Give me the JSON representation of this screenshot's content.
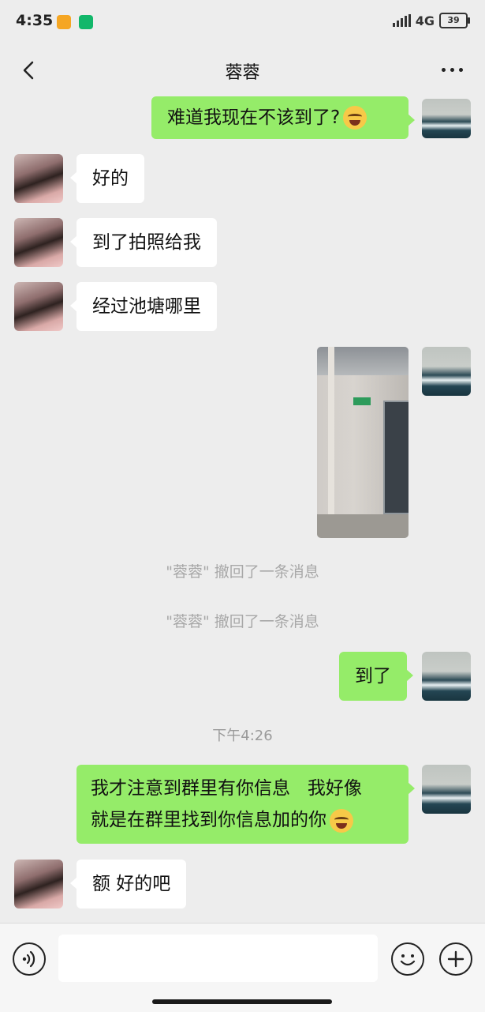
{
  "status_bar": {
    "time": "4:35",
    "network": "4G",
    "battery": "39"
  },
  "header": {
    "title": "蓉蓉"
  },
  "messages": [
    {
      "from": "me",
      "text": "难道我现在不该到了?",
      "emoji": "face-with-tears-of-joy"
    },
    {
      "from": "contact",
      "text": "好的"
    },
    {
      "from": "contact",
      "text": "到了拍照给我"
    },
    {
      "from": "contact",
      "text": "经过池塘哪里"
    },
    {
      "from": "me",
      "type": "photo"
    },
    {
      "type": "system",
      "text": "\"蓉蓉\" 撤回了一条消息"
    },
    {
      "type": "system",
      "text": "\"蓉蓉\" 撤回了一条消息"
    },
    {
      "from": "me",
      "text": "到了"
    },
    {
      "type": "timestamp",
      "text": "下午4:26"
    },
    {
      "from": "me",
      "lines": [
        "我才注意到群里有你信息   我好像",
        "就是在群里找到你信息加的你"
      ],
      "emoji": "face-with-tears-of-joy"
    },
    {
      "from": "contact",
      "text": "额 好的吧"
    }
  ],
  "input_bar": {
    "value": "",
    "placeholder": ""
  },
  "colors": {
    "background": "#ededed",
    "outgoing_bubble": "#95ec69",
    "incoming_bubble": "#ffffff"
  }
}
